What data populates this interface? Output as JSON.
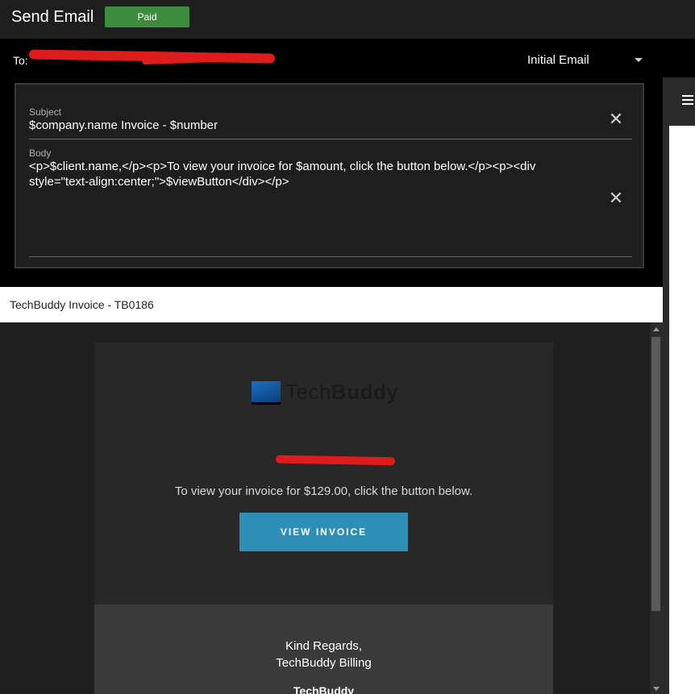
{
  "header": {
    "title": "Send Email",
    "status_badge": "Paid",
    "to_label": "To:",
    "template": "Initial Email"
  },
  "editor": {
    "subject_label": "Subject",
    "subject_value": "$company.name Invoice - $number",
    "body_label": "Body",
    "body_value": "<p>$client.name,</p><p>To view your invoice for $amount, click the button below.</p><p><div style=\"text-align:center;\">$viewButton</div></p>"
  },
  "preview": {
    "subject": "TechBuddy Invoice - TB0186",
    "logo_text_light": "Tech",
    "logo_text_bold": "Buddy",
    "message": "To view your invoice for $129.00, click the button below.",
    "button_label": "VIEW INVOICE",
    "signoff_line1": "Kind Regards,",
    "signoff_line2": "TechBuddy Billing",
    "footer_company": "TechBuddy"
  },
  "colors": {
    "paid_badge": "#3d8b3d",
    "button": "#2e8fb6",
    "redaction": "#e01b1b"
  },
  "icons": {
    "clear": "close-icon",
    "dropdown": "chevron-down-icon",
    "menu": "hamburger-icon"
  }
}
